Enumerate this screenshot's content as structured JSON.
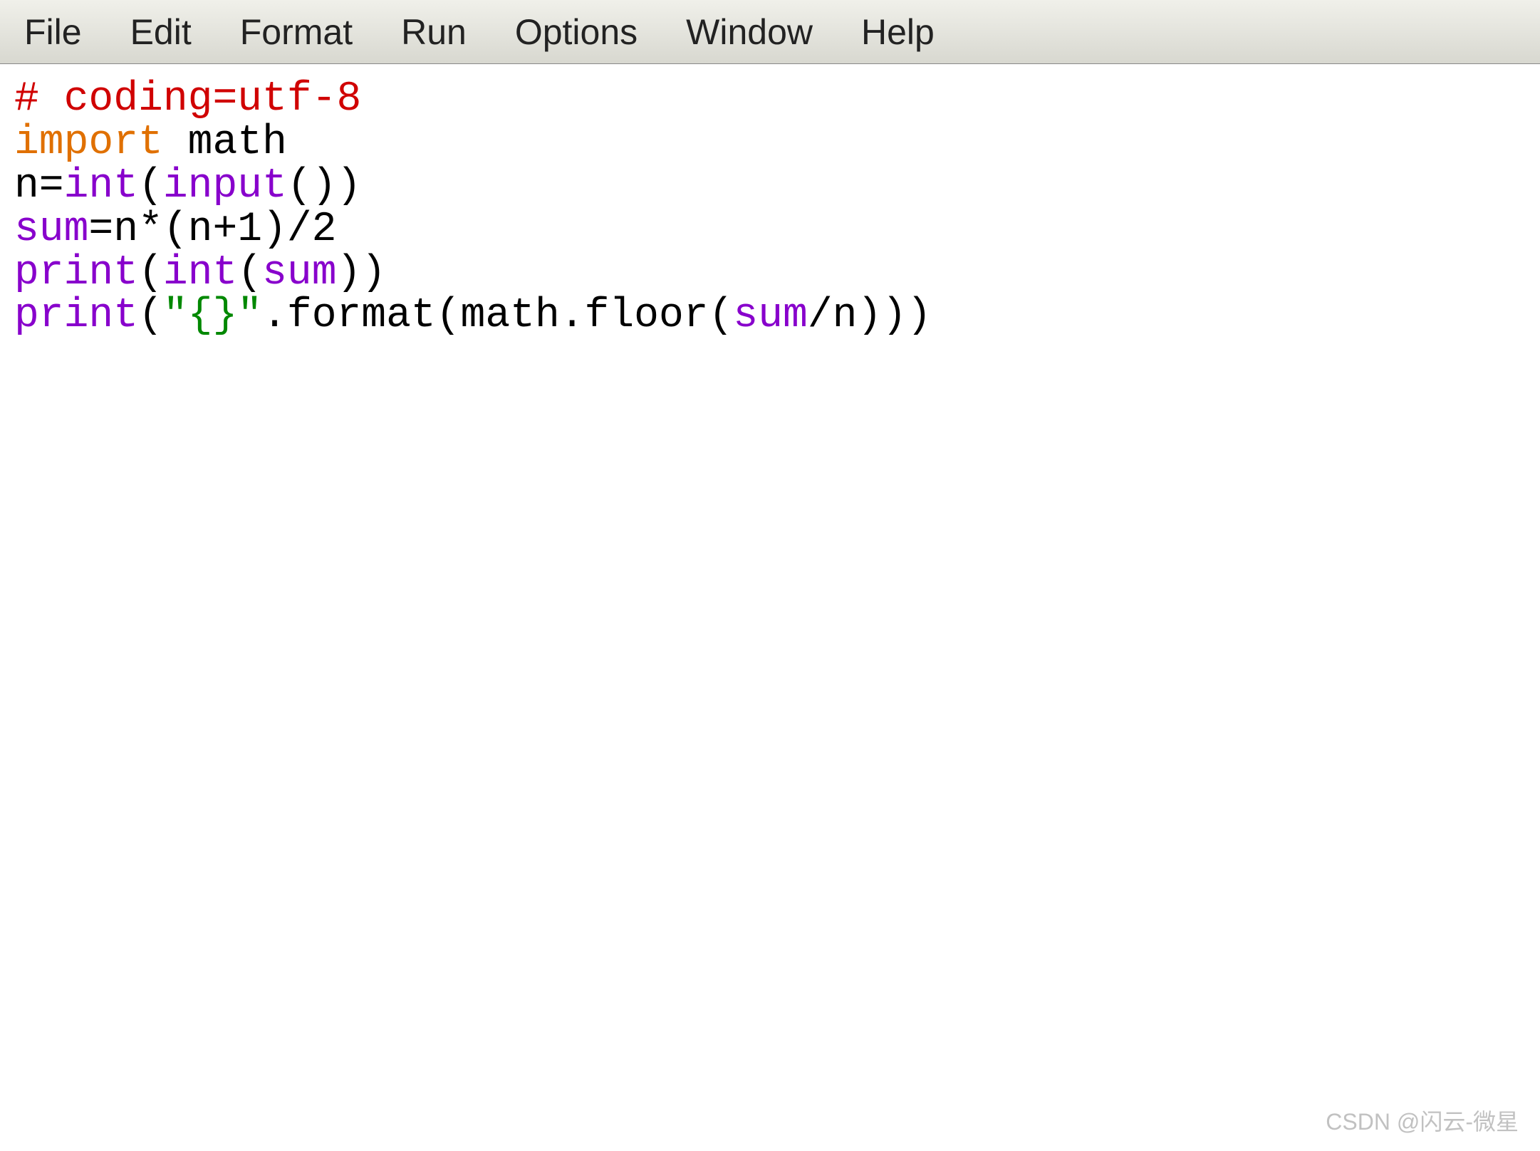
{
  "menubar": {
    "items": [
      {
        "label": "File"
      },
      {
        "label": "Edit"
      },
      {
        "label": "Format"
      },
      {
        "label": "Run"
      },
      {
        "label": "Options"
      },
      {
        "label": "Window"
      },
      {
        "label": "Help"
      }
    ]
  },
  "code": {
    "lines": [
      {
        "tokens": [
          {
            "cls": "tok-comment",
            "text": "# coding=utf-8"
          }
        ]
      },
      {
        "tokens": [
          {
            "cls": "tok-keyword",
            "text": "import"
          },
          {
            "cls": "tok-normal",
            "text": " math"
          }
        ]
      },
      {
        "tokens": [
          {
            "cls": "tok-normal",
            "text": "n="
          },
          {
            "cls": "tok-builtin",
            "text": "int"
          },
          {
            "cls": "tok-normal",
            "text": "("
          },
          {
            "cls": "tok-builtin",
            "text": "input"
          },
          {
            "cls": "tok-normal",
            "text": "())"
          }
        ]
      },
      {
        "tokens": [
          {
            "cls": "tok-builtin",
            "text": "sum"
          },
          {
            "cls": "tok-normal",
            "text": "=n*(n+1)/2"
          }
        ]
      },
      {
        "tokens": [
          {
            "cls": "tok-builtin",
            "text": "print"
          },
          {
            "cls": "tok-normal",
            "text": "("
          },
          {
            "cls": "tok-builtin",
            "text": "int"
          },
          {
            "cls": "tok-normal",
            "text": "("
          },
          {
            "cls": "tok-builtin",
            "text": "sum"
          },
          {
            "cls": "tok-normal",
            "text": "))"
          }
        ]
      },
      {
        "tokens": [
          {
            "cls": "tok-builtin",
            "text": "print"
          },
          {
            "cls": "tok-normal",
            "text": "("
          },
          {
            "cls": "tok-string",
            "text": "\"{}\""
          },
          {
            "cls": "tok-normal",
            "text": ".format(math.floor("
          },
          {
            "cls": "tok-builtin",
            "text": "sum"
          },
          {
            "cls": "tok-normal",
            "text": "/n)))"
          }
        ]
      }
    ]
  },
  "watermark": {
    "text": "CSDN @闪云-微星"
  }
}
